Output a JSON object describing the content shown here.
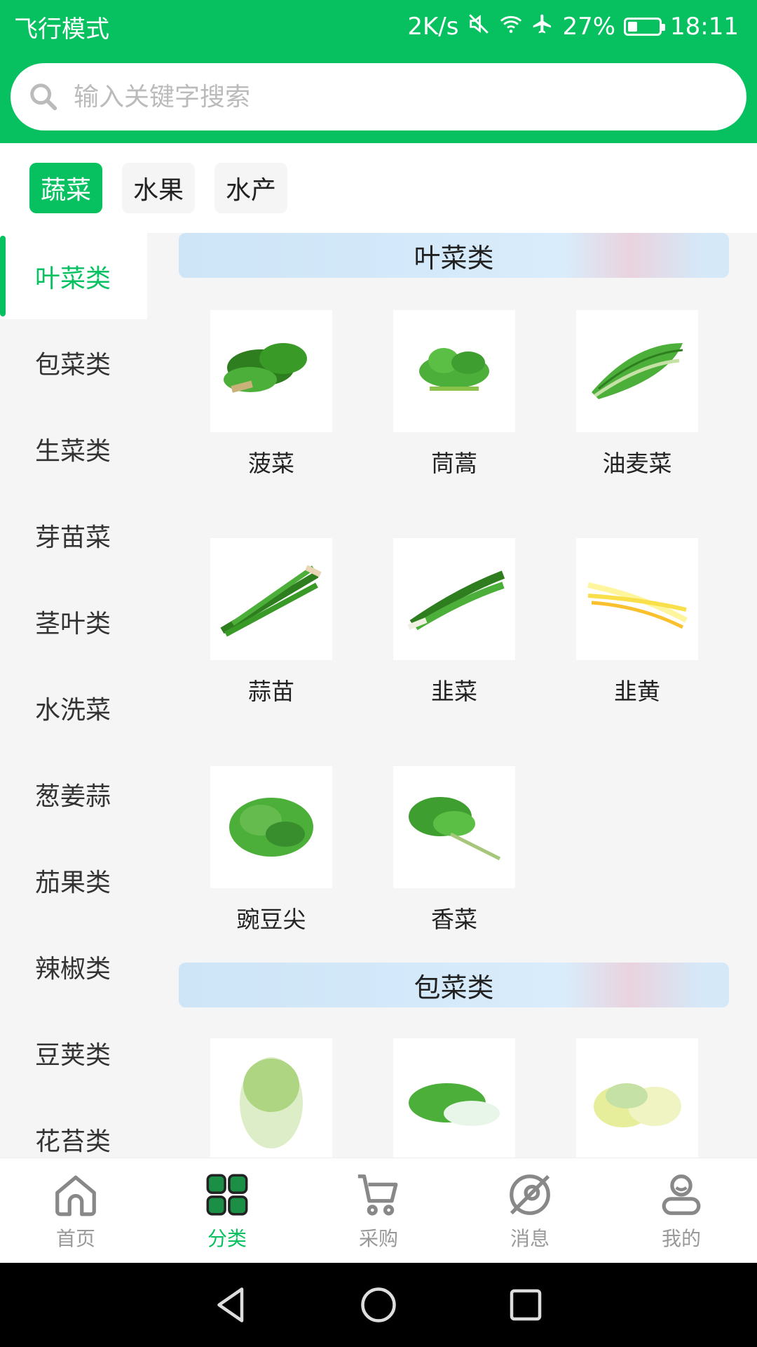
{
  "status_bar": {
    "left": "飞行模式",
    "speed": "2K/s",
    "battery": "27%",
    "battery_level": 0.27,
    "time": "18:11"
  },
  "search": {
    "placeholder": "输入关键字搜索"
  },
  "top_tabs": [
    {
      "label": "蔬菜",
      "active": true
    },
    {
      "label": "水果",
      "active": false
    },
    {
      "label": "水产",
      "active": false
    }
  ],
  "sidebar": {
    "items": [
      {
        "label": "叶菜类",
        "active": true
      },
      {
        "label": "包菜类"
      },
      {
        "label": "生菜类"
      },
      {
        "label": "芽苗菜"
      },
      {
        "label": "茎叶类"
      },
      {
        "label": "水洗菜"
      },
      {
        "label": "葱姜蒜"
      },
      {
        "label": "茄果类"
      },
      {
        "label": "辣椒类"
      },
      {
        "label": "豆荚类"
      },
      {
        "label": "花苔类"
      }
    ]
  },
  "sections": [
    {
      "title": "叶菜类",
      "products": [
        "菠菜",
        "茼蒿",
        "油麦菜",
        "蒜苗",
        "韭菜",
        "韭黄",
        "豌豆尖",
        "香菜"
      ]
    },
    {
      "title": "包菜类",
      "products": [
        "",
        "",
        ""
      ]
    }
  ],
  "bottom_nav": [
    {
      "label": "首页",
      "icon": "home-icon"
    },
    {
      "label": "分类",
      "icon": "category-grid-icon",
      "active": true
    },
    {
      "label": "采购",
      "icon": "cart-icon"
    },
    {
      "label": "消息",
      "icon": "message-icon"
    },
    {
      "label": "我的",
      "icon": "profile-icon"
    }
  ],
  "colors": {
    "brand": "#07c160",
    "background": "#f5f5f5"
  }
}
